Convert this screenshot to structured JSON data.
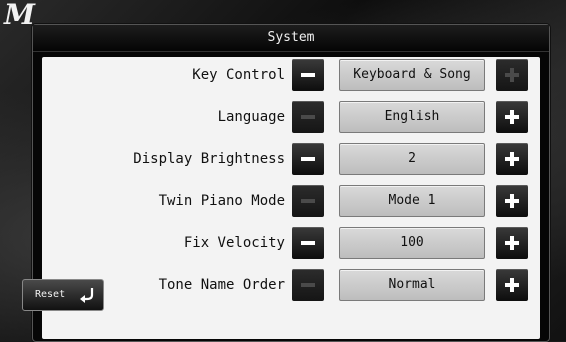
{
  "app": {
    "logo_letter": "M"
  },
  "dialog": {
    "title": "System"
  },
  "rows": [
    {
      "label": "Key Control",
      "value": "Keyboard & Song",
      "minus_enabled": true,
      "plus_enabled": false
    },
    {
      "label": "Language",
      "value": "English",
      "minus_enabled": false,
      "plus_enabled": true
    },
    {
      "label": "Display Brightness",
      "value": "2",
      "minus_enabled": true,
      "plus_enabled": true
    },
    {
      "label": "Twin Piano Mode",
      "value": "Mode 1",
      "minus_enabled": false,
      "plus_enabled": true
    },
    {
      "label": "Fix Velocity",
      "value": "100",
      "minus_enabled": true,
      "plus_enabled": true
    },
    {
      "label": "Tone Name Order",
      "value": "Normal",
      "minus_enabled": false,
      "plus_enabled": true
    }
  ],
  "reset": {
    "label": "Reset",
    "icon": "return-arrow-icon"
  },
  "icons": {
    "minus": "minus-icon",
    "plus": "plus-icon"
  }
}
